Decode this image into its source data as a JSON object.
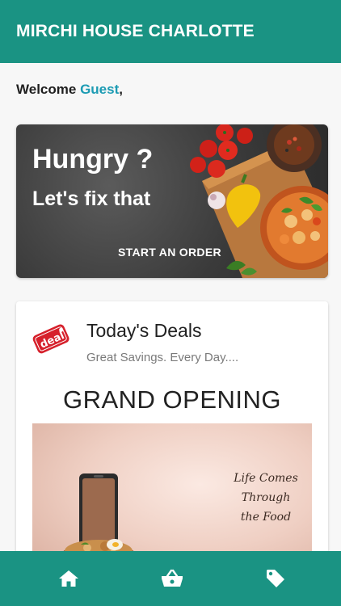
{
  "app": {
    "title": "MIRCHI HOUSE CHARLOTTE"
  },
  "welcome": {
    "prefix": "Welcome",
    "name": "Guest",
    "suffix": ","
  },
  "hero": {
    "headline": "Hungry ?",
    "subheadline": "Let's fix that",
    "cta": "START AN ORDER"
  },
  "deals": {
    "icon_text": "deal",
    "title": "Today's Deals",
    "subtitle": "Great Savings. Every Day....",
    "promo_heading": "GRAND OPENING",
    "promo_script": [
      "Life Comes",
      "Through",
      "the Food"
    ]
  },
  "bottom_nav": {
    "items": [
      {
        "icon": "home-icon"
      },
      {
        "icon": "basket-icon"
      },
      {
        "icon": "tag-icon"
      }
    ]
  },
  "colors": {
    "primary": "#1a9383",
    "accent": "#1c9bb3"
  }
}
